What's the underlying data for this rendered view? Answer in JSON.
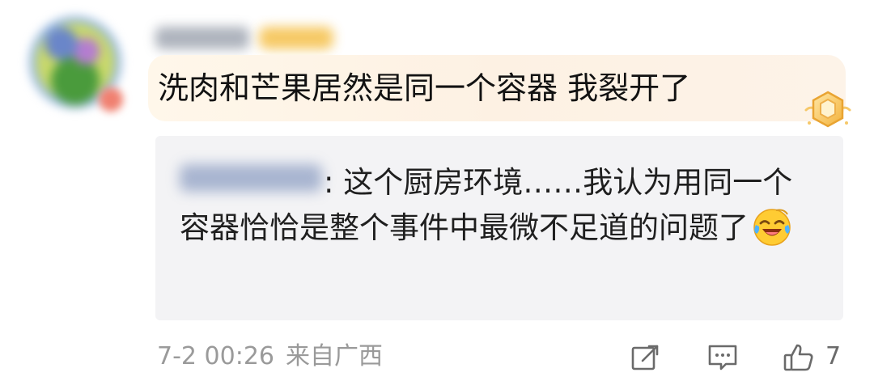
{
  "comment": {
    "text": "洗肉和芒果居然是同一个容器 我裂开了",
    "avatar_icon": "avatar-blurred",
    "username_blurred": true,
    "badge_icon": "medal-icon"
  },
  "reply": {
    "separator": ":",
    "text": " 这个厨房环境……我认为用同一个容器恰恰是整个事件中最微不足道的问题了",
    "emoji": "laughing-crying-emoji"
  },
  "meta": {
    "date": "7-2 00:26",
    "location": "来自广西"
  },
  "actions": {
    "share_icon": "share-icon",
    "comment_icon": "comment-icon",
    "like_icon": "thumbs-up-icon",
    "like_count": "7"
  },
  "colors": {
    "bubble": "#fff4e6",
    "reply_bg": "#f3f3f5",
    "meta_text": "#9a9a9a",
    "icon": "#6a6a6a"
  }
}
